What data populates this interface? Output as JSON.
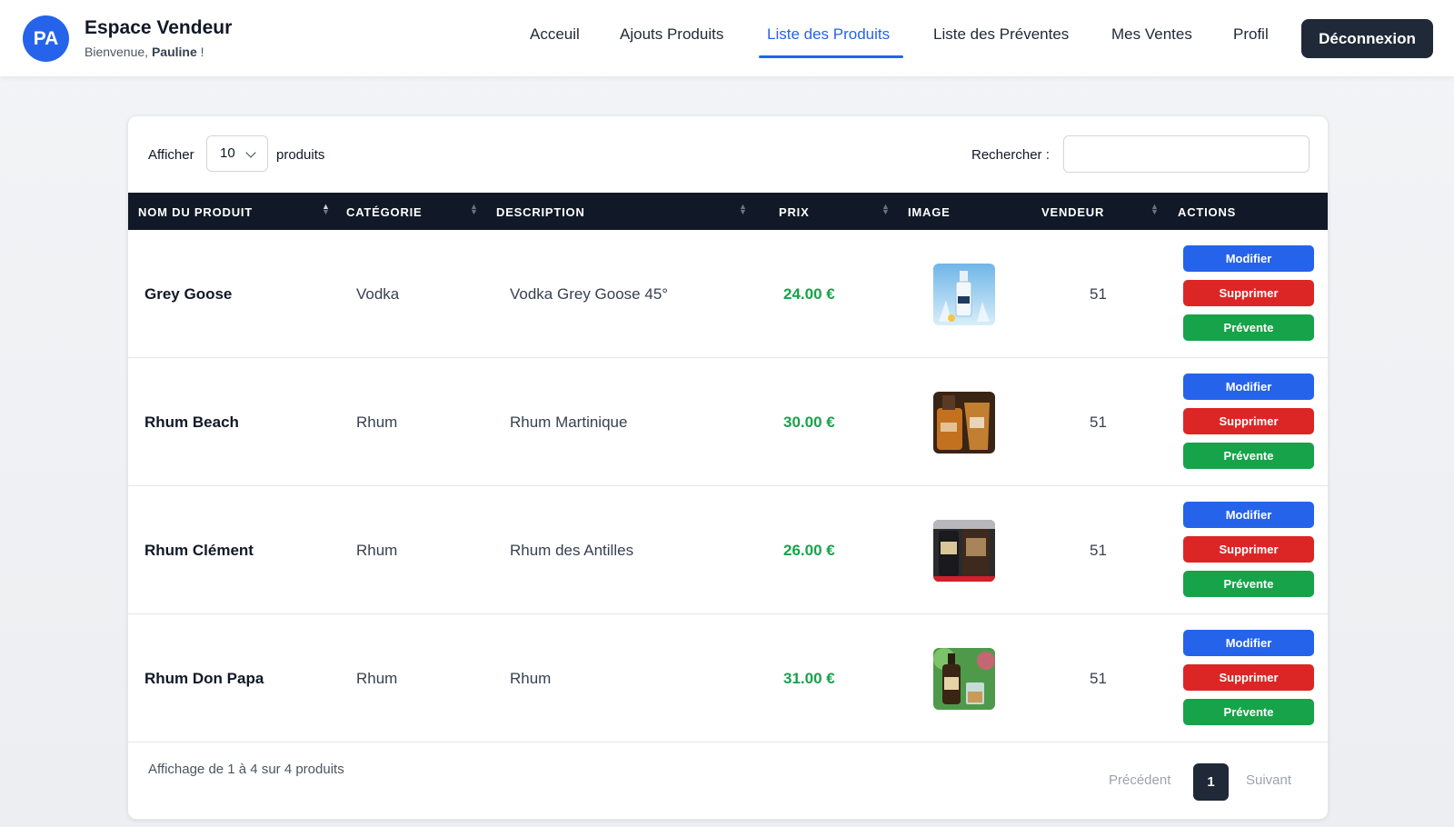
{
  "header": {
    "avatar_initials": "PA",
    "title": "Espace Vendeur",
    "greeting_prefix": "Bienvenue, ",
    "user_name": "Pauline",
    "greeting_suffix": " !",
    "nav": [
      {
        "label": "Acceuil"
      },
      {
        "label": "Ajouts Produits"
      },
      {
        "label": "Liste des Produits",
        "active": true
      },
      {
        "label": "Liste des Préventes"
      },
      {
        "label": "Mes Ventes"
      },
      {
        "label": "Profil"
      }
    ],
    "logout_label": "Déconnexion",
    "accent_color": "#2563eb"
  },
  "controls": {
    "show_label": "Afficher",
    "page_size": "10",
    "after_label": "produits",
    "search_label": "Rechercher :",
    "search_value": ""
  },
  "table": {
    "columns": [
      "NOM DU PRODUIT",
      "CATÉGORIE",
      "DESCRIPTION",
      "PRIX",
      "IMAGE",
      "VENDEUR",
      "ACTIONS"
    ],
    "rows": [
      {
        "name": "Grey Goose",
        "category": "Vodka",
        "description": "Vodka Grey Goose 45°",
        "price": "24.00 €",
        "image": "vodka-bottle-image",
        "vendor": "51"
      },
      {
        "name": "Rhum Beach",
        "category": "Rhum",
        "description": "Rhum Martinique",
        "price": "30.00 €",
        "image": "rum-bottle-image",
        "vendor": "51"
      },
      {
        "name": "Rhum Clément",
        "category": "Rhum",
        "description": "Rhum des Antilles",
        "price": "26.00 €",
        "image": "rum-bottle-image",
        "vendor": "51"
      },
      {
        "name": "Rhum Don Papa",
        "category": "Rhum",
        "description": "Rhum",
        "price": "31.00 €",
        "image": "rum-bottle-image",
        "vendor": "51"
      }
    ],
    "actions": {
      "edit": "Modifier",
      "delete": "Supprimer",
      "presale": "Prévente"
    },
    "colors": {
      "edit": "#2563eb",
      "delete": "#dc2626",
      "presale": "#16a34a",
      "price": "#16a34a"
    }
  },
  "footer": {
    "info": "Affichage de 1 à 4 sur 4 produits",
    "prev": "Précédent",
    "page": "1",
    "next": "Suivant"
  }
}
